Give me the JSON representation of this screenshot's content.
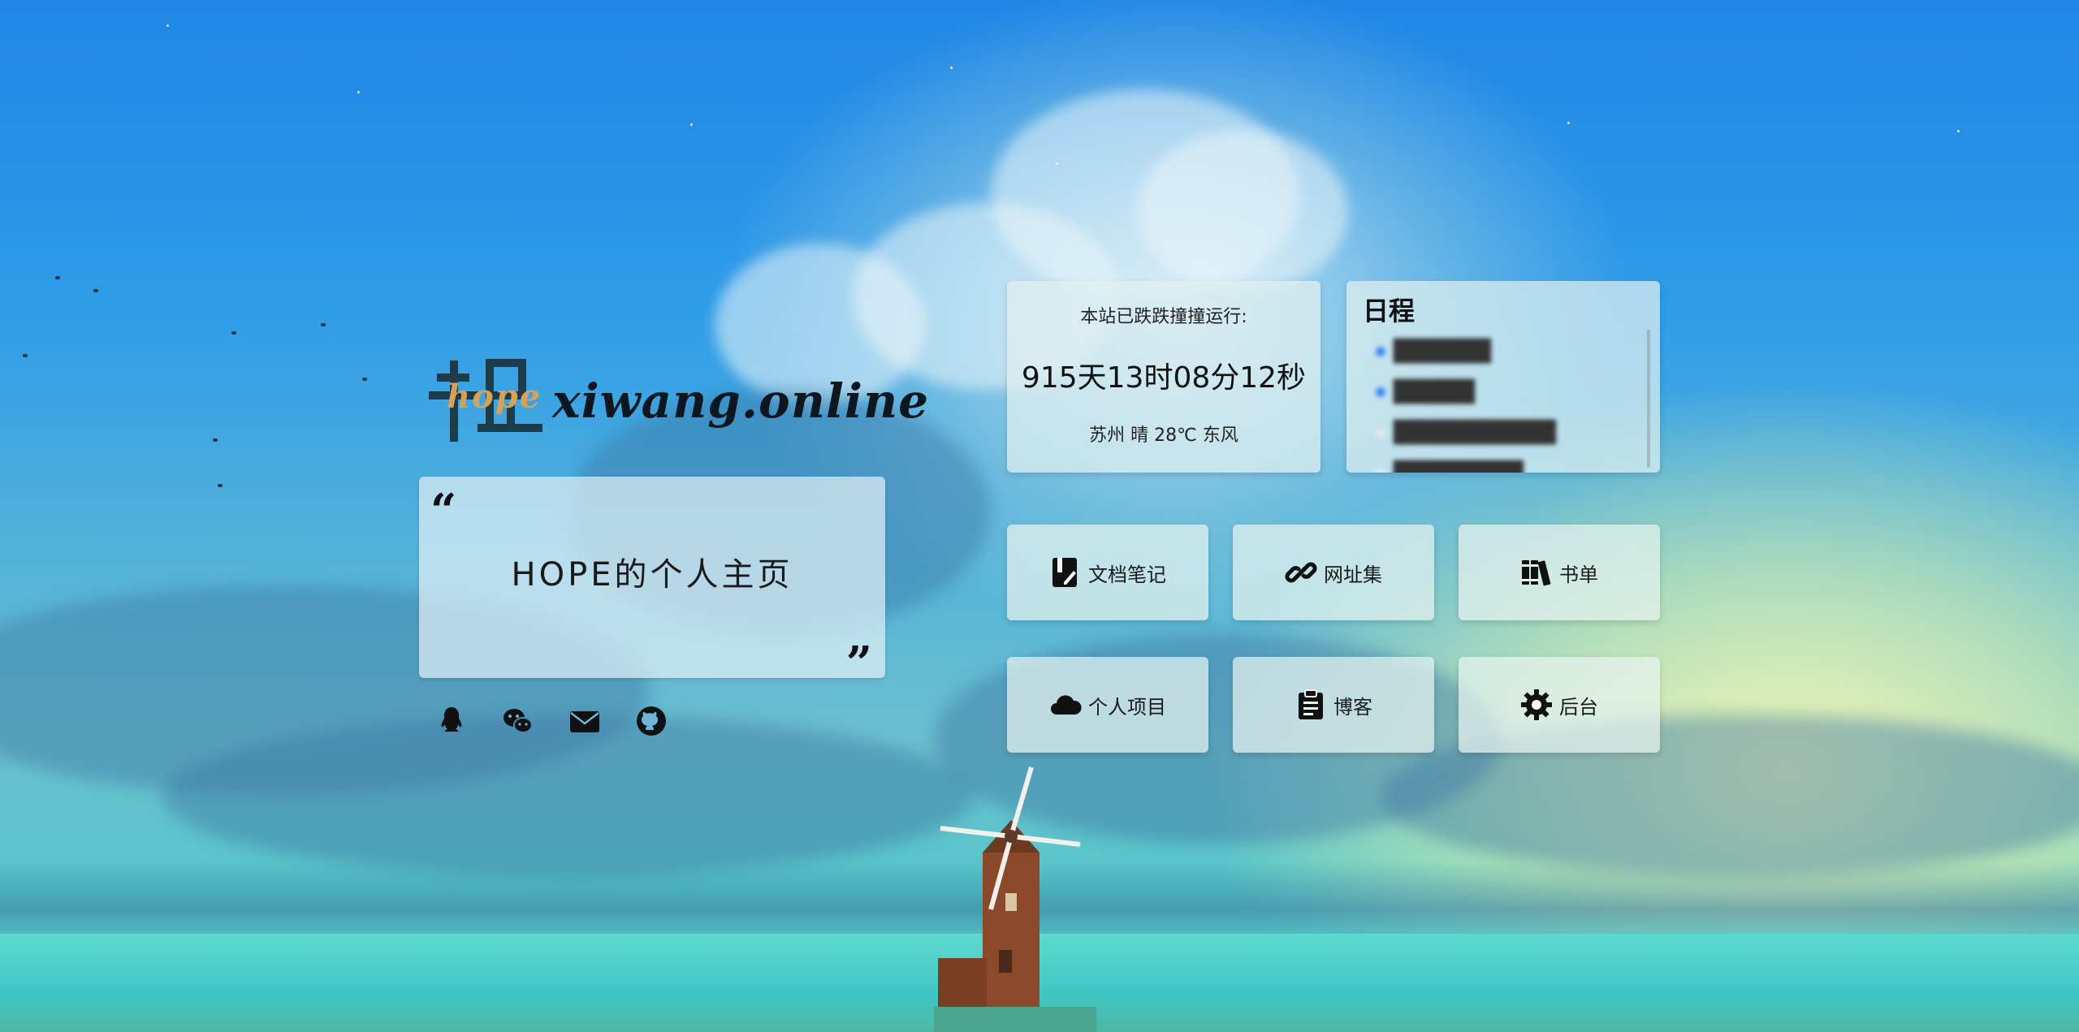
{
  "site": {
    "logo_cn": "希望",
    "logo_hope": "hope",
    "logo_domain": "xiwang.online"
  },
  "quote": {
    "open_mark": "“",
    "text": "HOPE的个人主页",
    "close_mark": "”"
  },
  "socials": [
    {
      "icon": "qq-icon"
    },
    {
      "icon": "wechat-icon"
    },
    {
      "icon": "mail-icon"
    },
    {
      "icon": "github-icon"
    }
  ],
  "uptime": {
    "label": "本站已跌跌撞撞运行:",
    "value": "915天13时08分12秒",
    "weather": "苏州 晴 28℃ 东风"
  },
  "schedule": {
    "title": "日程",
    "items": [
      {
        "text": "██████",
        "dot": "#3a86f0"
      },
      {
        "text": "█████",
        "dot": "#3a86f0"
      },
      {
        "text": "██████████",
        "dot": "#e6e6e6"
      },
      {
        "text": "████████",
        "dot": "#e6e6e6"
      }
    ]
  },
  "links": [
    {
      "label": "文档笔记",
      "icon": "notebook-icon"
    },
    {
      "label": "网址集",
      "icon": "link-icon"
    },
    {
      "label": "书单",
      "icon": "books-icon"
    },
    {
      "label": "个人项目",
      "icon": "cloud-icon"
    },
    {
      "label": "博客",
      "icon": "clipboard-icon"
    },
    {
      "label": "后台",
      "icon": "gear-icon"
    }
  ]
}
